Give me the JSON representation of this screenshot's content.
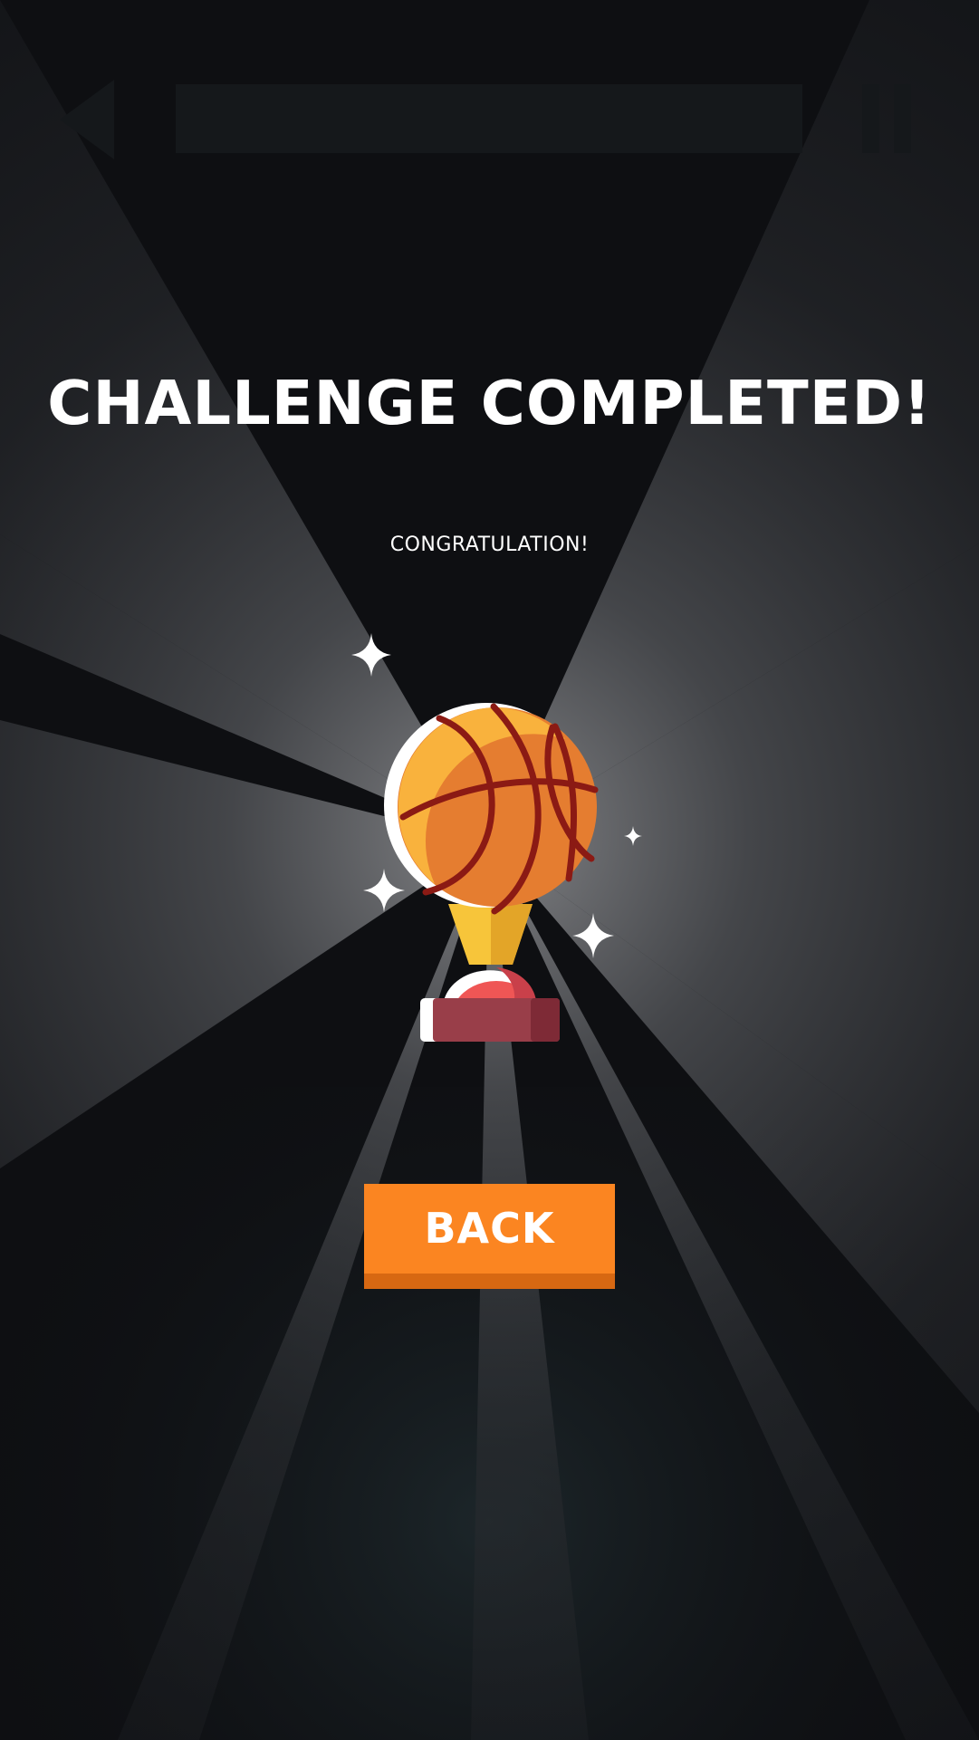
{
  "screen": {
    "title": "CHALLENGE COMPLETED!",
    "subtitle": "CONGRATULATION!",
    "back_button_label": "BACK"
  },
  "hud": {
    "back_icon": "back-triangle-icon",
    "pause_icon": "pause-icon"
  },
  "illustration": {
    "trophy_icon": "basketball-trophy-icon",
    "sparkle_icon": "sparkle-icon"
  },
  "colors": {
    "background": "#0e0f12",
    "hud": "#15181b",
    "button": "#fb8521",
    "button_shadow": "#d76812",
    "ball": "#f9b23d",
    "ball_shade": "#e57d30",
    "ball_lines": "#8b1a14",
    "cup": "#f7c53a",
    "base_top": "#ef5655",
    "base": "#993e49"
  }
}
